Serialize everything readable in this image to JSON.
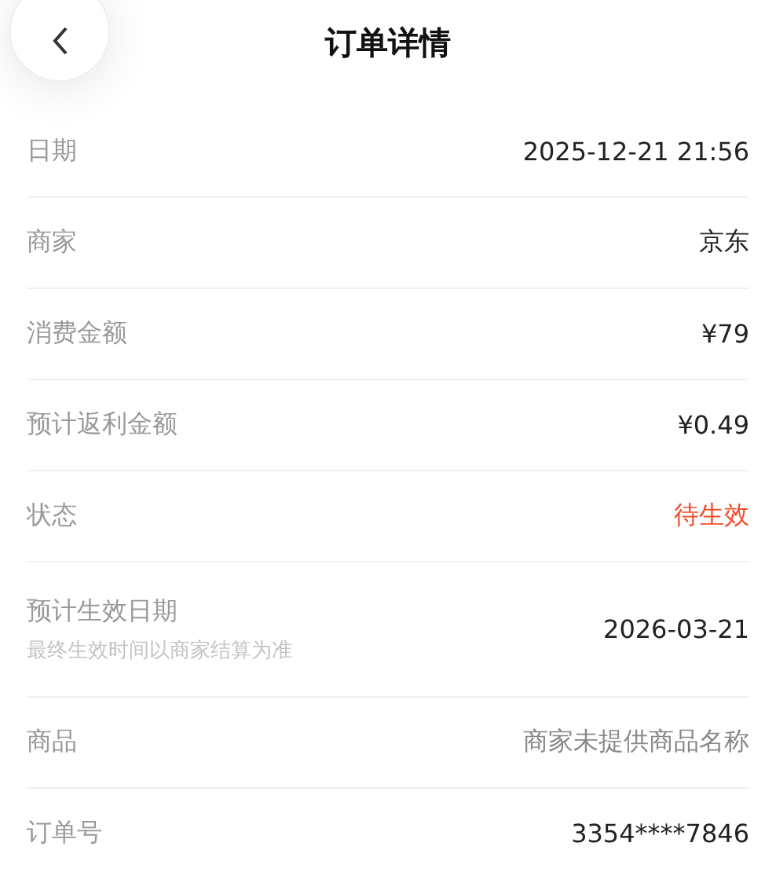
{
  "header": {
    "title": "订单详情"
  },
  "rows": [
    {
      "label": "日期",
      "value": "2025-12-21 21:56",
      "kind": "normal"
    },
    {
      "label": "商家",
      "value": "京东",
      "kind": "normal"
    },
    {
      "label": "消费金额",
      "value": "¥79",
      "kind": "normal"
    },
    {
      "label": "预计返利金额",
      "value": "¥0.49",
      "kind": "normal"
    },
    {
      "label": "状态",
      "value": "待生效",
      "kind": "alert"
    },
    {
      "label": "预计生效日期",
      "note": "最终生效时间以商家结算为准",
      "value": "2026-03-21",
      "kind": "normal"
    },
    {
      "label": "商品",
      "value": "商家未提供商品名称",
      "kind": "muted"
    },
    {
      "label": "订单号",
      "value": "3354****7846",
      "kind": "normal"
    }
  ]
}
